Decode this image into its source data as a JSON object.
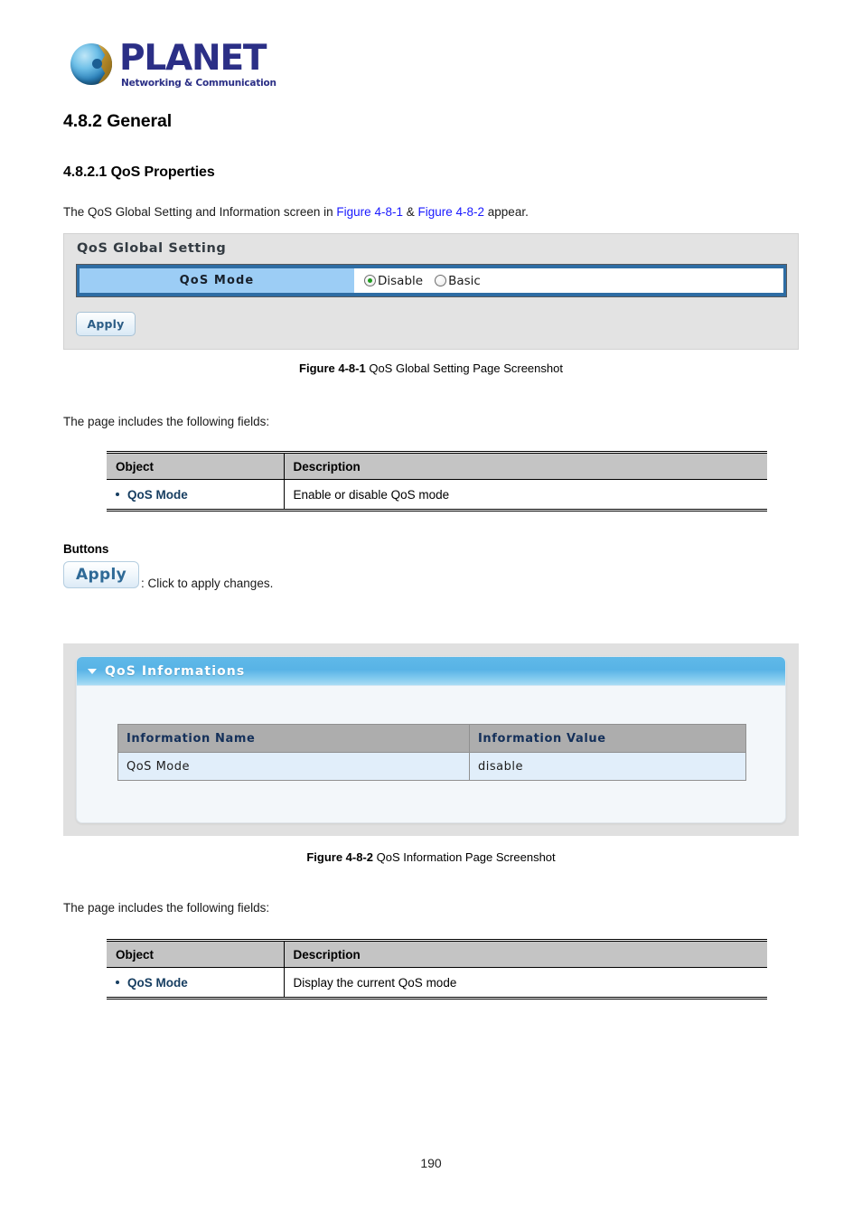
{
  "brand": {
    "name": "PLANET",
    "tagline": "Networking & Communication",
    "logo_icon": "planet-globe-logo"
  },
  "document": {
    "section_heading": "4.8.2 General",
    "subsection_heading": "4.8.2.1 QoS Properties",
    "intro_prefix": "The QoS Global Setting and Information screen in ",
    "intro_link1": "Figure 4-8-1",
    "intro_amp": " & ",
    "intro_link2": "Figure 4-8-2",
    "intro_suffix": " appear.",
    "fields_note_1": "The page includes the following fields:",
    "fields_note_2": "The page includes the following fields:",
    "buttons_heading": "Buttons",
    "page_number": "190",
    "link_color": "#1a1aff"
  },
  "figure1": {
    "caption_bold": "Figure 4-8-1",
    "caption_rest": " QoS Global Setting Page Screenshot",
    "panel_title": "QoS Global Setting",
    "row_label": "QoS Mode",
    "radios": [
      {
        "label": "Disable",
        "checked": true
      },
      {
        "label": "Basic",
        "checked": false
      }
    ],
    "apply_label": "Apply",
    "colors": {
      "panel_bg": "#e3e3e3",
      "label_cell": "#9ccdf5",
      "row_border": "#2e6da4",
      "radio_dot": "#1f9c1f"
    }
  },
  "figure2": {
    "caption_bold": "Figure 4-8-2",
    "caption_rest": " QoS Information Page Screenshot",
    "panel_title": "QoS Informations",
    "collapse_icon": "triangle-down-icon",
    "table": {
      "headers": [
        "Information Name",
        "Information Value"
      ],
      "rows": [
        [
          "QoS Mode",
          "disable"
        ]
      ]
    },
    "colors": {
      "header_bar_start": "#5fb9e8",
      "header_bar_end": "#a9dcf4",
      "table_header_bg": "#adadad",
      "table_row_bg": "#e1eefa",
      "table_header_text": "#14305a"
    }
  },
  "buttons_section": {
    "apply_label": "Apply",
    "apply_description": ": Click to apply changes."
  },
  "table1": {
    "headers": [
      "Object",
      "Description"
    ],
    "rows": [
      {
        "object": "QoS Mode",
        "description": "Enable or disable QoS mode"
      }
    ]
  },
  "table2": {
    "headers": [
      "Object",
      "Description"
    ],
    "rows": [
      {
        "object": "QoS Mode",
        "description": "Display the current QoS mode"
      }
    ]
  }
}
